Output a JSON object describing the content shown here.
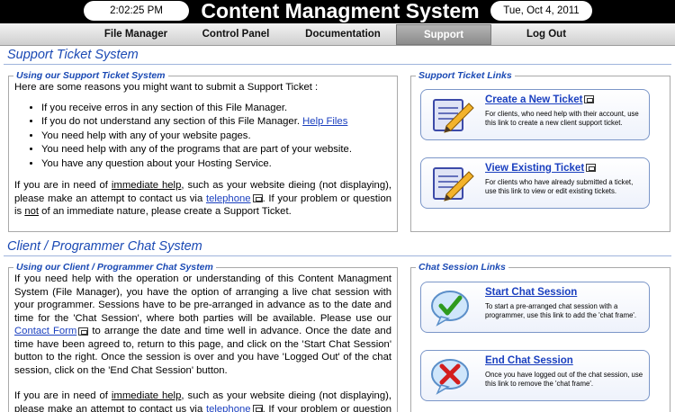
{
  "header": {
    "time": "2:02:25 PM",
    "title": "Content Managment System",
    "date": "Tue, Oct 4, 2011"
  },
  "nav": {
    "items": [
      {
        "label": "File Manager"
      },
      {
        "label": "Control Panel"
      },
      {
        "label": "Documentation"
      },
      {
        "label": "Support",
        "active": true
      },
      {
        "label": "Log Out"
      }
    ]
  },
  "support": {
    "section_title": "Support Ticket System",
    "box_legend": "Using our Support Ticket System",
    "intro": "Here are some reasons you might want to submit a Support Ticket :",
    "reasons": [
      "If you receive erros in any section of this File Manager.",
      "If you do not understand any section of this File Manager.",
      "You need help with any of your website pages.",
      "You need help with any of the programs that are part of your website.",
      "You have any question about your Hosting Service."
    ],
    "help_files_link": "Help Files",
    "p_urgent_1": "If you are in need of",
    "immediate_help": "immediate help",
    "p_urgent_2": ", such as your website dieing (not displaying), please make an attempt to contact us via",
    "telephone_link": "telephone",
    "p_urgent_3": ". If your problem or question is",
    "not_word": "not",
    "p_urgent_4": "of an immediate nature, please create a Support Ticket.",
    "links_legend": "Support Ticket Links",
    "links": [
      {
        "title": "Create a New Ticket",
        "desc": "For clients, who need help with their account, use this link to create a new client support ticket.",
        "icon": "notepad-pencil-icon"
      },
      {
        "title": "View Existing Ticket",
        "desc": "For clients who have already submitted a ticket, use this link to view or edit existing tickets.",
        "icon": "notepad-pencil-icon"
      }
    ]
  },
  "chat": {
    "section_title": "Client / Programmer Chat System",
    "box_legend": "Using our Client / Programmer Chat System",
    "p1_a": "If you need help with the operation or understanding of this Content Managment System (File Manager), you have the option of arranging a live chat session with your programmer. Sessions have to be pre-arranged in advance as to the date and time for the 'Chat Session', where both parties will be available. Please use our",
    "contact_form_link": "Contact Form",
    "p1_b": "to arrange the date and time well in advance. Once the date and time have been agreed to, return to this page, and click on the 'Start Chat Session' button to the right. Once the session is over and you have 'Logged Out' of the chat session, click on the 'End Chat Session' button.",
    "p2_a": "If you are in need of",
    "immediate_help": "immediate help",
    "p2_b": ", such as your website dieing (not displaying), please make an attempt to contact us via",
    "telephone_link": "telephone",
    "p2_c": ". If your problem or question is",
    "links_legend": "Chat Session Links",
    "links": [
      {
        "title": "Start Chat Session",
        "desc": "To start a pre-arranged chat session with a programmer, use this link to add the 'chat frame'.",
        "icon": "chat-bubble-check-icon"
      },
      {
        "title": "End Chat Session",
        "desc": "Once you have logged out of the chat session, use this link to remove the 'chat frame'.",
        "icon": "chat-bubble-x-icon"
      }
    ]
  },
  "colors": {
    "accent_blue": "#1a49b4",
    "link_blue": "#1a3fbf",
    "header_black": "#000000",
    "nav_active": "#9a9a9a"
  }
}
